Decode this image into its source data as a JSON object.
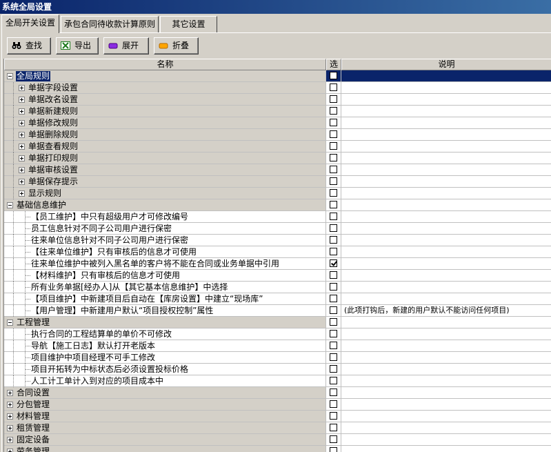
{
  "window": {
    "title": "系统全局设置"
  },
  "tabs": [
    {
      "label": "全局开关设置",
      "active": true
    },
    {
      "label": "承包合同待收款计算原则",
      "active": false
    },
    {
      "label": "其它设置",
      "active": false
    }
  ],
  "toolbar": {
    "find_label": "查找",
    "export_label": "导出",
    "expand_label": "展开",
    "collapse_label": "折叠"
  },
  "columns": {
    "name": "名称",
    "check": "选",
    "desc": "说明"
  },
  "rows": [
    {
      "label": "全局规则",
      "level": 0,
      "expander": "minus",
      "checked": false,
      "desc": "",
      "selected": true
    },
    {
      "label": "单据字段设置",
      "level": 1,
      "expander": "plus",
      "checked": false,
      "desc": ""
    },
    {
      "label": "单据改名设置",
      "level": 1,
      "expander": "plus",
      "checked": false,
      "desc": ""
    },
    {
      "label": "单据新建规则",
      "level": 1,
      "expander": "plus",
      "checked": false,
      "desc": ""
    },
    {
      "label": "单据修改规则",
      "level": 1,
      "expander": "plus",
      "checked": false,
      "desc": ""
    },
    {
      "label": "单据删除规则",
      "level": 1,
      "expander": "plus",
      "checked": false,
      "desc": ""
    },
    {
      "label": "单据查看规则",
      "level": 1,
      "expander": "plus",
      "checked": false,
      "desc": ""
    },
    {
      "label": "单据打印规则",
      "level": 1,
      "expander": "plus",
      "checked": false,
      "desc": ""
    },
    {
      "label": "单据审核设置",
      "level": 1,
      "expander": "plus",
      "checked": false,
      "desc": ""
    },
    {
      "label": "单据保存提示",
      "level": 1,
      "expander": "plus",
      "checked": false,
      "desc": ""
    },
    {
      "label": "显示规则",
      "level": 1,
      "expander": "plus",
      "checked": false,
      "desc": ""
    },
    {
      "label": "基础信息维护",
      "level": 0,
      "expander": "minus",
      "checked": false,
      "desc": ""
    },
    {
      "label": "【员工维护】中只有超级用户才可修改编号",
      "level": 2,
      "expander": "none",
      "checked": false,
      "desc": ""
    },
    {
      "label": "员工信息针对不同子公司用户进行保密",
      "level": 2,
      "expander": "none",
      "checked": false,
      "desc": ""
    },
    {
      "label": "往来单位信息针对不同子公司用户进行保密",
      "level": 2,
      "expander": "none",
      "checked": false,
      "desc": ""
    },
    {
      "label": "【往来单位维护】只有审核后的信息才可使用",
      "level": 2,
      "expander": "none",
      "checked": false,
      "desc": ""
    },
    {
      "label": "往来单位维护中被列入黑名单的客户将不能在合同或业务单据中引用",
      "level": 2,
      "expander": "none",
      "checked": true,
      "desc": ""
    },
    {
      "label": "【材料维护】只有审核后的信息才可使用",
      "level": 2,
      "expander": "none",
      "checked": false,
      "desc": ""
    },
    {
      "label": "所有业务单据[经办人]从【其它基本信息维护】中选择",
      "level": 2,
      "expander": "none",
      "checked": false,
      "desc": ""
    },
    {
      "label": "【项目维护】中新建项目后自动在【库房设置】中建立“现场库”",
      "level": 2,
      "expander": "none",
      "checked": false,
      "desc": ""
    },
    {
      "label": "【用户管理】中新建用户默认“项目授权控制”属性",
      "level": 2,
      "expander": "none",
      "checked": false,
      "desc": "(此项打钩后，新建的用户默认不能访问任何项目)"
    },
    {
      "label": "工程管理",
      "level": 0,
      "expander": "minus",
      "checked": false,
      "desc": ""
    },
    {
      "label": "执行合同的工程结算单的单价不可修改",
      "level": 2,
      "expander": "none",
      "checked": false,
      "desc": ""
    },
    {
      "label": "导航【施工日志】默认打开老版本",
      "level": 2,
      "expander": "none",
      "checked": false,
      "desc": ""
    },
    {
      "label": "项目维护中项目经理不可手工修改",
      "level": 2,
      "expander": "none",
      "checked": false,
      "desc": ""
    },
    {
      "label": "项目开拓转为中标状态后必须设置投标价格",
      "level": 2,
      "expander": "none",
      "checked": false,
      "desc": ""
    },
    {
      "label": "人工计工单计入到对应的项目成本中",
      "level": 2,
      "expander": "none",
      "checked": false,
      "desc": ""
    },
    {
      "label": "合同设置",
      "level": 0,
      "expander": "plus",
      "checked": false,
      "desc": ""
    },
    {
      "label": "分包管理",
      "level": 0,
      "expander": "plus",
      "checked": false,
      "desc": ""
    },
    {
      "label": "材料管理",
      "level": 0,
      "expander": "plus",
      "checked": false,
      "desc": ""
    },
    {
      "label": "租赁管理",
      "level": 0,
      "expander": "plus",
      "checked": false,
      "desc": ""
    },
    {
      "label": "固定设备",
      "level": 0,
      "expander": "plus",
      "checked": false,
      "desc": ""
    },
    {
      "label": "劳务管理",
      "level": 0,
      "expander": "plus",
      "checked": false,
      "desc": ""
    }
  ]
}
